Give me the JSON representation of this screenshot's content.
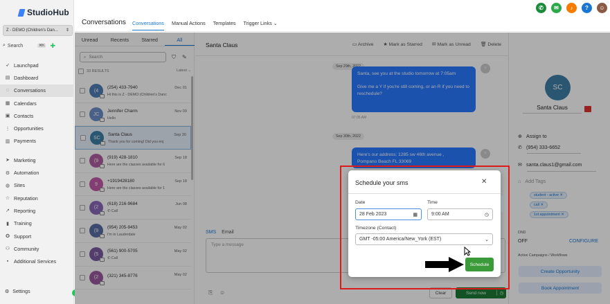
{
  "brand": {
    "name": "StudioHub"
  },
  "account": {
    "name": "Z - DEMO (Children's Dan..."
  },
  "sidebar_search": {
    "placeholder": "Search",
    "shortcut": "⌘K"
  },
  "nav": [
    {
      "label": "Launchpad",
      "icon": "rocket-icon"
    },
    {
      "label": "Dashboard",
      "icon": "dashboard-icon"
    },
    {
      "label": "Conversations",
      "icon": "chat-icon",
      "active": true
    },
    {
      "label": "Calendars",
      "icon": "calendar-icon"
    },
    {
      "label": "Contacts",
      "icon": "contacts-icon"
    },
    {
      "label": "Opportunities",
      "icon": "opportunities-icon"
    },
    {
      "label": "Payments",
      "icon": "payments-icon"
    },
    {
      "label": "Marketing",
      "icon": "send-icon"
    },
    {
      "label": "Automation",
      "icon": "automation-icon"
    },
    {
      "label": "Sites",
      "icon": "globe-icon"
    },
    {
      "label": "Reputation",
      "icon": "star-icon"
    },
    {
      "label": "Reporting",
      "icon": "chart-icon"
    },
    {
      "label": "Training",
      "icon": "book-icon"
    },
    {
      "label": "Support",
      "icon": "support-icon"
    },
    {
      "label": "Community",
      "icon": "community-icon"
    },
    {
      "label": "Additional Services",
      "icon": "services-icon"
    }
  ],
  "settings": {
    "label": "Settings"
  },
  "header": {
    "title": "Conversations",
    "tabs": [
      "Conversations",
      "Manual Actions",
      "Templates",
      "Trigger Links ⌄"
    ],
    "top_icons": [
      {
        "name": "phone-icon",
        "glyph": "✆",
        "color": "#1b8a3a"
      },
      {
        "name": "chat-bubble-icon",
        "glyph": "✉",
        "color": "#2ba84a"
      },
      {
        "name": "bell-icon",
        "glyph": "♪",
        "color": "#f57c00"
      },
      {
        "name": "help-icon",
        "glyph": "?",
        "color": "#1976d2"
      },
      {
        "name": "profile-avatar",
        "glyph": "☺",
        "color": "#8a5a44"
      }
    ]
  },
  "list": {
    "subtabs": [
      "Unread",
      "Recents",
      "Starred",
      "All"
    ],
    "search_placeholder": "Search",
    "results": "33 RESULTS",
    "sort": "Latest",
    "items": [
      {
        "initials": "(4",
        "color": "#4f7eb5",
        "name": "(254) 433-7940",
        "preview": "Hi this is Z - DEMO (Children's Danc",
        "date": "Dec 01"
      },
      {
        "initials": "JC",
        "color": "#6c8ec7",
        "name": "Jennifer Charm",
        "preview": "Hello",
        "date": "Nov 09"
      },
      {
        "initials": "SC",
        "color": "#3e7fa8",
        "name": "Santa Claus",
        "preview": "Thank you for coming! Did you enj",
        "date": "Sep 30",
        "selected": true
      },
      {
        "initials": "(9",
        "color": "#b35ea0",
        "name": "(919) 428-1810",
        "preview": "Here are the classes available for 6",
        "date": "Sep 18"
      },
      {
        "initials": "9",
        "color": "#c25aa8",
        "name": "+1919428180",
        "preview": "Here are the classes available for 1",
        "date": "Sep 18"
      },
      {
        "initials": "(2",
        "color": "#8a68b8",
        "name": "(618) 216-9684",
        "preview": "Call",
        "date": "Jun 08"
      },
      {
        "initials": "(9",
        "color": "#5b6ea5",
        "name": "(954) 205-9453",
        "preview": "I'm in Lauderdale",
        "date": "May 02"
      },
      {
        "initials": "(5",
        "color": "#7a5aa0",
        "name": "(561) 900-5705",
        "preview": "Call",
        "date": "May 02"
      },
      {
        "initials": "(2",
        "color": "#9a5aa0",
        "name": "(321) 345-8776",
        "preview": "",
        "date": "May 02"
      }
    ]
  },
  "chat": {
    "contact": "Santa Claus",
    "actions": [
      {
        "label": "Archive",
        "icon": "archive-icon",
        "glyph": "▭"
      },
      {
        "label": "Mark as Starred",
        "icon": "star-icon",
        "glyph": "★"
      },
      {
        "label": "Mark as Unread",
        "icon": "mail-icon",
        "glyph": "✉"
      },
      {
        "label": "Delete",
        "icon": "trash-icon",
        "glyph": "🗑"
      }
    ],
    "messages": [
      {
        "date": "Sep 29th, 2022",
        "text1": "Santa, see you at the studio tomorrow at 7:05am",
        "text2": "Give me a Y if you're still coming, or an R if you need to reschedule?",
        "time": "07:05 AM"
      },
      {
        "date": "Sep 30th, 2022",
        "text1": "Here's our address: 1285 sw 46th avenue ,",
        "text2": "Pompano Beach FL 33069"
      }
    ],
    "compose_tabs": [
      "SMS",
      "Email"
    ],
    "compose_placeholder": "Type a message",
    "clear": "Clear",
    "send": "Send now"
  },
  "contact": {
    "initials": "SC",
    "name": "Santa Claus",
    "assign": "Assign to",
    "phone": "(954) 333-6652",
    "email": "santa.claus1@gmail.com",
    "tags_placeholder": "Add Tags",
    "tags": [
      "student - active",
      "call",
      "1st appointment"
    ],
    "dnd_label": "DND",
    "dnd_value": "OFF",
    "configure": "CONFIGURE",
    "campaigns": "Active Campaigns / Workflows",
    "btn_opportunity": "Create Opportunity",
    "btn_appointment": "Book Appointment"
  },
  "modal": {
    "title": "Schedule your sms",
    "date_label": "Date",
    "date_value": "28 Feb 2023",
    "time_label": "Time",
    "time_value": "9:00 AM",
    "tz_label": "Timezone (Contact)",
    "tz_value": "GMT -05:00 America/New_York (EST)",
    "schedule": "Schedule"
  }
}
